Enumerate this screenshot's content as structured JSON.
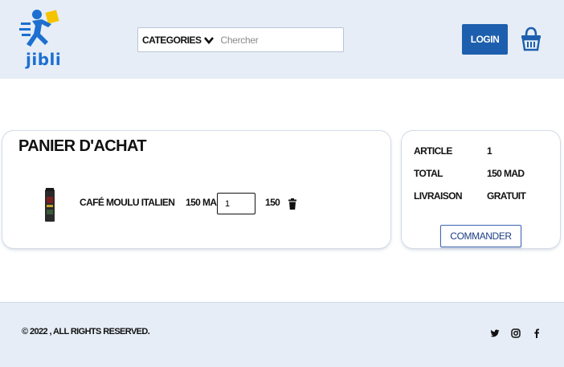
{
  "header": {
    "logo_text": "jibli",
    "categories_label": "CATEGORIES",
    "search_placeholder": "Chercher",
    "login_label": "LOGIN"
  },
  "cart": {
    "title": "PANIER D'ACHAT",
    "items": [
      {
        "name": "CAFÉ MOULU ITALIEN",
        "price": "150 MAD",
        "quantity": "1",
        "total": "150"
      }
    ]
  },
  "summary": {
    "article_label": "ARTICLE",
    "article_value": "1",
    "total_label": "TOTAL",
    "total_value": "150 MAD",
    "livraison_label": "LIVRAISON",
    "livraison_value": "GRATUIT",
    "commander_label": "COMMANDER"
  },
  "footer": {
    "copyright": "© 2022 , ALL RIGHTS RESERVED."
  },
  "icons": {
    "logo": "jibli-runner-logo-icon",
    "chevron": "chevron-down-icon",
    "cart": "basket-icon",
    "trash": "trash-icon",
    "twitter": "twitter-icon",
    "instagram": "instagram-icon",
    "facebook": "facebook-icon"
  },
  "colors": {
    "brand_blue": "#1d5fae",
    "header_bg": "#e6edf6",
    "logo_yellow": "#f5c400"
  }
}
